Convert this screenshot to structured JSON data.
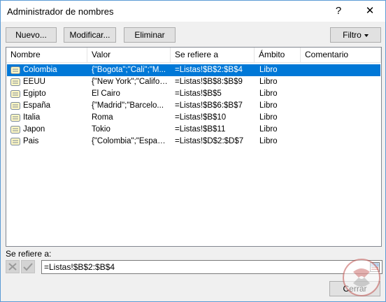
{
  "window": {
    "title": "Administrador de nombres",
    "help_glyph": "?",
    "close_glyph": "✕"
  },
  "toolbar": {
    "nuevo": "Nuevo...",
    "modificar": "Modificar...",
    "eliminar": "Eliminar",
    "filtro": "Filtro"
  },
  "columns": [
    "Nombre",
    "Valor",
    "Se refiere a",
    "Ámbito",
    "Comentario"
  ],
  "rows": [
    {
      "nombre": "Colombia",
      "valor": "{\"Bogota\";\"Cali\";\"M...",
      "refiere": "=Listas!$B$2:$B$4",
      "ambito": "Libro",
      "comentario": "",
      "selected": true
    },
    {
      "nombre": "EEUU",
      "valor": "{\"New York\";\"Califor...",
      "refiere": "=Listas!$B$8:$B$9",
      "ambito": "Libro",
      "comentario": ""
    },
    {
      "nombre": "Egipto",
      "valor": "El Cairo",
      "refiere": "=Listas!$B$5",
      "ambito": "Libro",
      "comentario": ""
    },
    {
      "nombre": "España",
      "valor": "{\"Madrid\";\"Barcelo...",
      "refiere": "=Listas!$B$6:$B$7",
      "ambito": "Libro",
      "comentario": ""
    },
    {
      "nombre": "Italia",
      "valor": "Roma",
      "refiere": "=Listas!$B$10",
      "ambito": "Libro",
      "comentario": ""
    },
    {
      "nombre": "Japon",
      "valor": "Tokio",
      "refiere": "=Listas!$B$11",
      "ambito": "Libro",
      "comentario": ""
    },
    {
      "nombre": "Pais",
      "valor": "{\"Colombia\";\"Españ...",
      "refiere": "=Listas!$D$2:$D$7",
      "ambito": "Libro",
      "comentario": ""
    }
  ],
  "reference": {
    "label": "Se refiere a:",
    "value": "=Listas!$B$2:$B$4"
  },
  "footer": {
    "cerrar": "Cerrar"
  },
  "colors": {
    "selection": "#0078d7",
    "border_accent": "#5b9bd5"
  }
}
